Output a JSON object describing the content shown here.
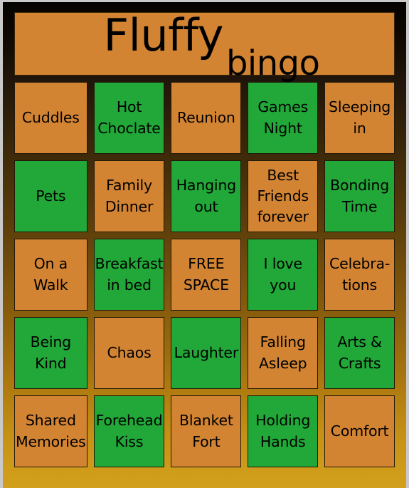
{
  "card": {
    "title_main": "Fluffy",
    "title_sub": "bingo",
    "colors": {
      "orange": "#d38433",
      "green": "#21a838",
      "text": "#000000",
      "card_top": "#060300",
      "card_bottom": "#d2a01c",
      "cell_border": "#23180a"
    },
    "grid": {
      "columns": 5,
      "rows": 5,
      "cells": [
        {
          "label": "Cuddles",
          "color": "orange",
          "marked": false
        },
        {
          "label": "Hot Choclate",
          "color": "green",
          "marked": true
        },
        {
          "label": "Reunion",
          "color": "orange",
          "marked": false
        },
        {
          "label": "Games Night",
          "color": "green",
          "marked": true
        },
        {
          "label": "Sleeping in",
          "color": "orange",
          "marked": false
        },
        {
          "label": "Pets",
          "color": "green",
          "marked": true
        },
        {
          "label": "Family Dinner",
          "color": "orange",
          "marked": false
        },
        {
          "label": "Hanging out",
          "color": "green",
          "marked": true
        },
        {
          "label": "Best Friends forever",
          "color": "orange",
          "marked": false
        },
        {
          "label": "Bonding Time",
          "color": "green",
          "marked": true
        },
        {
          "label": "On a Walk",
          "color": "orange",
          "marked": false
        },
        {
          "label": "Breakfast in bed",
          "color": "green",
          "marked": true
        },
        {
          "label": "FREE SPACE",
          "color": "orange",
          "marked": false
        },
        {
          "label": "I love you",
          "color": "green",
          "marked": true
        },
        {
          "label": "Celebra- tions",
          "color": "orange",
          "marked": false
        },
        {
          "label": "Being Kind",
          "color": "green",
          "marked": true
        },
        {
          "label": "Chaos",
          "color": "orange",
          "marked": false
        },
        {
          "label": "Laughter",
          "color": "green",
          "marked": true
        },
        {
          "label": "Falling Asleep",
          "color": "orange",
          "marked": false
        },
        {
          "label": "Arts & Crafts",
          "color": "green",
          "marked": true
        },
        {
          "label": "Shared Memories",
          "color": "orange",
          "marked": false
        },
        {
          "label": "Forehead Kiss",
          "color": "green",
          "marked": true
        },
        {
          "label": "Blanket Fort",
          "color": "orange",
          "marked": false
        },
        {
          "label": "Holding Hands",
          "color": "green",
          "marked": true
        },
        {
          "label": "Comfort",
          "color": "orange",
          "marked": false
        }
      ]
    }
  }
}
